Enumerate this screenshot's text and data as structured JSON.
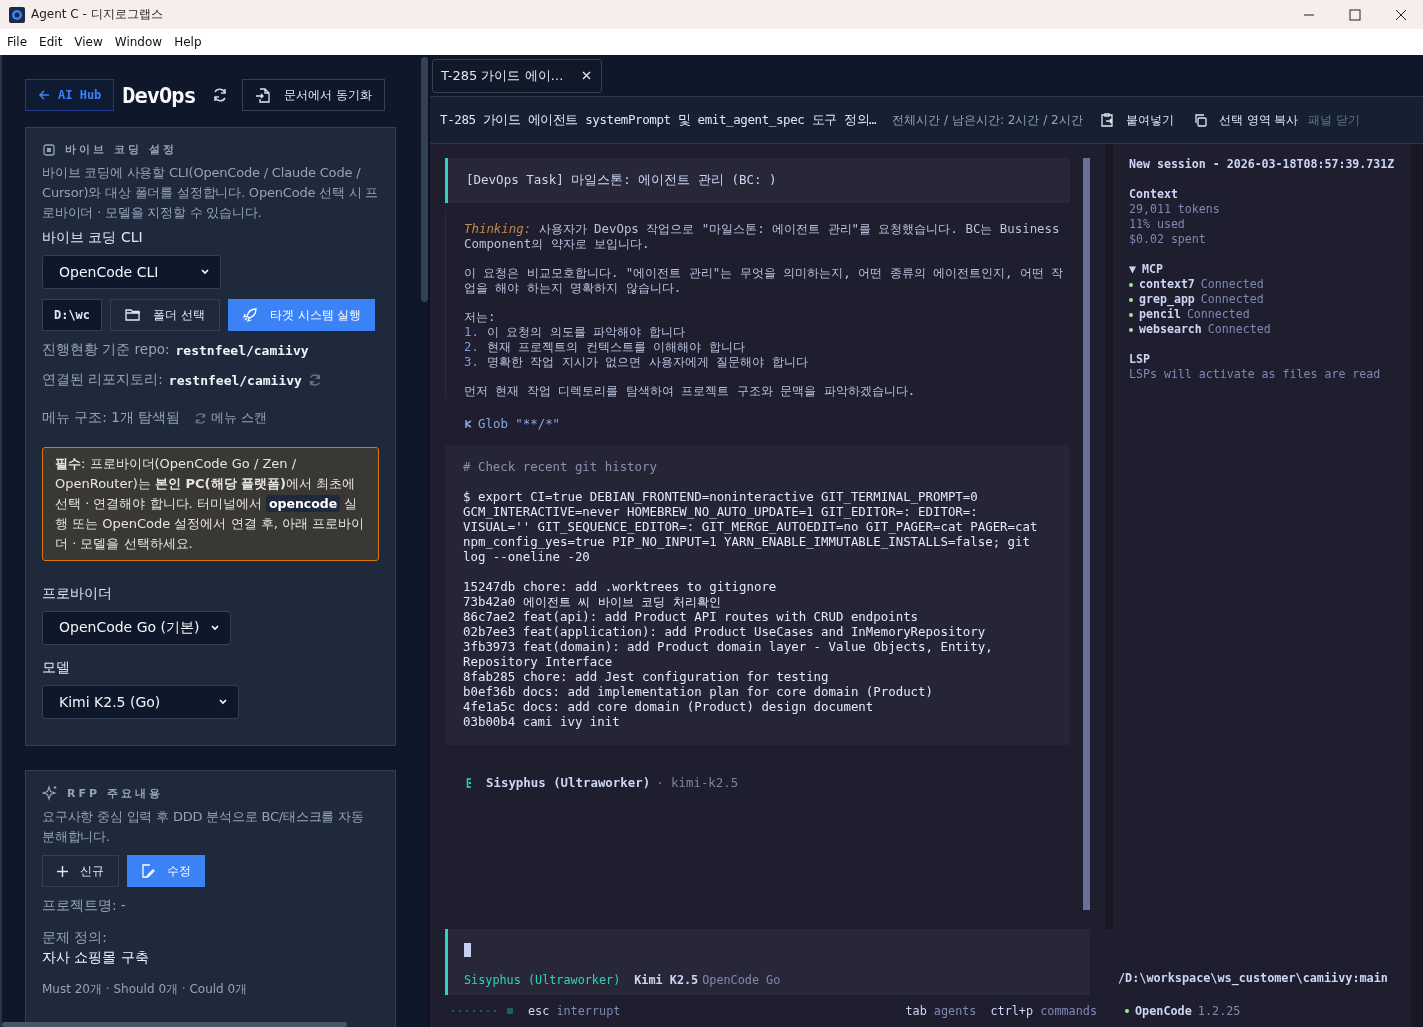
{
  "window": {
    "title": "Agent C - 디지로그랩스"
  },
  "menu": [
    "File",
    "Edit",
    "View",
    "Window",
    "Help"
  ],
  "left": {
    "back_button": "AI Hub",
    "title": "DevOps",
    "sync_button": "문서에서 동기화",
    "vibe": {
      "heading": "바이브 코딩 설정",
      "description": "바이브 코딩에 사용할 CLI(OpenCode / Claude Code / Cursor)와 대상 폴더를 설정합니다. OpenCode 선택 시 프로바이더 · 모델을 지정할 수 있습니다.",
      "cli_label": "바이브 코딩 CLI",
      "cli_value": "OpenCode CLI",
      "folder_value": "D:\\wc",
      "folder_button": "폴더 선택",
      "run_button": "타겟 시스템 실행",
      "info": [
        {
          "label": "진행현황 기준 repo:",
          "value": "restnfeel/camiivy",
          "refresh": false
        },
        {
          "label": "연결된 리포지토리:",
          "value": "restnfeel/camiivy",
          "refresh": true
        }
      ],
      "menu_structure": "메뉴 구조: 1개 탐색됨",
      "scan_button": "메뉴 스캔",
      "notice": {
        "before": "**필수**: 프로바이더(OpenCode Go / Zen / OpenRouter)는 **본인 PC(해당 플랫폼)**에서 최초에 선택 · 연결해야 합니다. 터미널에서",
        "code": "opencode",
        "after": "실행 또는 OpenCode 설정에서 연결 후, 아래 프로바이더 · 모델을 선택하세요."
      },
      "provider_label": "프로바이더",
      "provider_value": "OpenCode Go (기본)",
      "model_label": "모델",
      "model_value": "Kimi K2.5 (Go)"
    },
    "rfp": {
      "heading": "RFP 주요내용",
      "description": "요구사항 중심 입력 후 DDD 분석으로 BC/태스크를 자동 분해합니다.",
      "new_button": "신규",
      "edit_button": "수정",
      "project_name": "프로젝트명: -",
      "problem_label": "문제 정의:",
      "problem_value": "자사 쇼핑몰 구축",
      "counts": "Must 20개 · Should 0개 · Could 0개"
    }
  },
  "tabs": [
    {
      "label": "T-285 가이드 에이…",
      "selected": true
    }
  ],
  "header": {
    "title": "T-285 가이드 에이전트 systemPrompt 및 emit_agent_spec 도구 정의…",
    "time": "전체시간 / 남은시간: 2시간 / 2시간",
    "paste_button": "붙여넣기",
    "copy_button": "선택 영역 복사",
    "close_button": "패널 닫기"
  },
  "terminal": {
    "task": "[DevOps Task] 마일스톤: 에이전트 관리 (BC: )",
    "thinking_label": "Thinking:",
    "thinking_intro": "사용자가 DevOps 작업으로 \"마일스톤: 에이전트 관리\"를 요청했습니다. BC는 Business Component의 약자로 보입니다.",
    "thinking_body": "이 요청은 비교모호합니다. \"에이전트 관리\"는 무엇을 의미하는지, 어떤 종류의 에이전트인지, 어떤 작업을 해야 하는지 명확하지 않습니다.",
    "thinking_lead": "저는:",
    "steps": [
      {
        "number": "1.",
        "text": "이 요청의 의도를 파악해야 합니다"
      },
      {
        "number": "2.",
        "text": "현재 프로젝트의 컨텍스트를 이해해야 합니다"
      },
      {
        "number": "3.",
        "text": "명확한 작업 지시가 없으면 사용자에게 질문해야 합니다"
      }
    ],
    "thinking_end": "먼저 현재 작업 디렉토리를 탐색하여 프로젝트 구조와 문맥을 파악하겠습니다.",
    "glob": "Glob \"**/*\"",
    "comment": "# Check recent git history",
    "command": "$ export CI=true DEBIAN_FRONTEND=noninteractive GIT_TERMINAL_PROMPT=0 GCM_INTERACTIVE=never HOMEBREW_NO_AUTO_UPDATE=1 GIT_EDITOR=: EDITOR=: VISUAL='' GIT_SEQUENCE_EDITOR=: GIT_MERGE_AUTOEDIT=no GIT_PAGER=cat PAGER=cat npm_config_yes=true PIP_NO_INPUT=1 YARN_ENABLE_IMMUTABLE_INSTALLS=false; git log --oneline -20",
    "output": [
      "15247db chore: add .worktrees to gitignore",
      "73b42a0 에이전트 씨 바이브 코딩 처리확인",
      "86c7ae2 feat(api): add Product API routes with CRUD endpoints",
      "02b7ee3 feat(application): add Product UseCases and InMemoryRepository",
      "3fb3973 feat(domain): add Product domain layer - Value Objects, Entity, Repository Interface",
      "8fab285 chore: add Jest configuration for testing",
      "b0ef36b docs: add implementation plan for core domain (Product)",
      "4fe1a5c docs: add core domain (Product) design document",
      "03b00b4 cami ivy init"
    ],
    "agent": "Sisyphus (Ultraworker)",
    "agent_model": "· kimi-k2.5",
    "input": {
      "agent": "Sisyphus (Ultraworker)",
      "model": "Kimi K2.5",
      "provider": "OpenCode Go"
    },
    "hints_left": [
      {
        "key": "esc",
        "label": "interrupt"
      }
    ],
    "hints_right": [
      {
        "key": "tab",
        "label": "agents"
      },
      {
        "key": "ctrl+p",
        "label": "commands"
      }
    ]
  },
  "sidebar": {
    "session": "New session - 2026-03-18T08:57:39.731Z",
    "context_heading": "Context",
    "context": [
      "29,011 tokens",
      "11% used",
      "$0.02 spent"
    ],
    "mcp_toggle": "▼",
    "mcp_heading": "MCP",
    "mcp": [
      {
        "name": "context7",
        "status": "Connected",
        "color": "#a6e3a1"
      },
      {
        "name": "grep_app",
        "status": "Connected",
        "color": "#a6e3a1"
      },
      {
        "name": "pencil",
        "status": "Connected",
        "color": "#a6e3a1"
      },
      {
        "name": "websearch",
        "status": "Connected",
        "color": "#a6e3a1"
      }
    ],
    "lsp_heading": "LSP",
    "lsp": "LSPs will activate as files are read",
    "path": "/D:\\workspace\\ws_customer\\camiivy:main",
    "app": {
      "name": "OpenCode",
      "version": "1.2.25",
      "color": "#a6e3a1"
    }
  }
}
